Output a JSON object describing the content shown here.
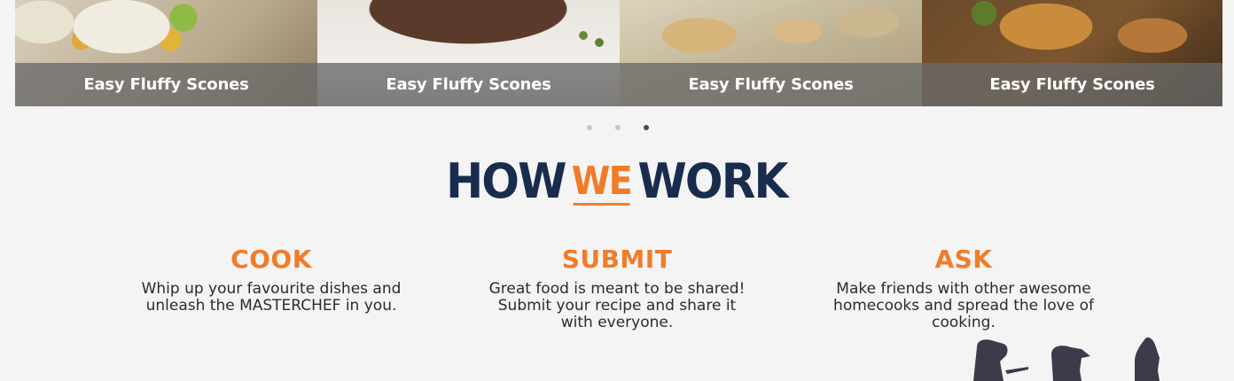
{
  "carousel": {
    "slides": [
      {
        "caption": "Easy Fluffy Scones"
      },
      {
        "caption": "Easy Fluffy Scones"
      },
      {
        "caption": "Easy Fluffy Scones"
      },
      {
        "caption": "Easy Fluffy Scones"
      }
    ],
    "dots_count": 3,
    "active_dot": 3
  },
  "headline": {
    "part1": "HOW",
    "part2": "WE",
    "part3": "WORK"
  },
  "steps": [
    {
      "title": "COOK",
      "text": "Whip up your favourite dishes and unleash the MASTERCHEF in you."
    },
    {
      "title": "SUBMIT",
      "text": "Great food is meant to be shared! Submit your recipe and share it with everyone."
    },
    {
      "title": "ASK",
      "text": "Make friends with other awesome homecooks and spread the love of cooking."
    }
  ],
  "colors": {
    "accent": "#f07c2a",
    "navy": "#182c4e",
    "caption_overlay": "#696969"
  }
}
